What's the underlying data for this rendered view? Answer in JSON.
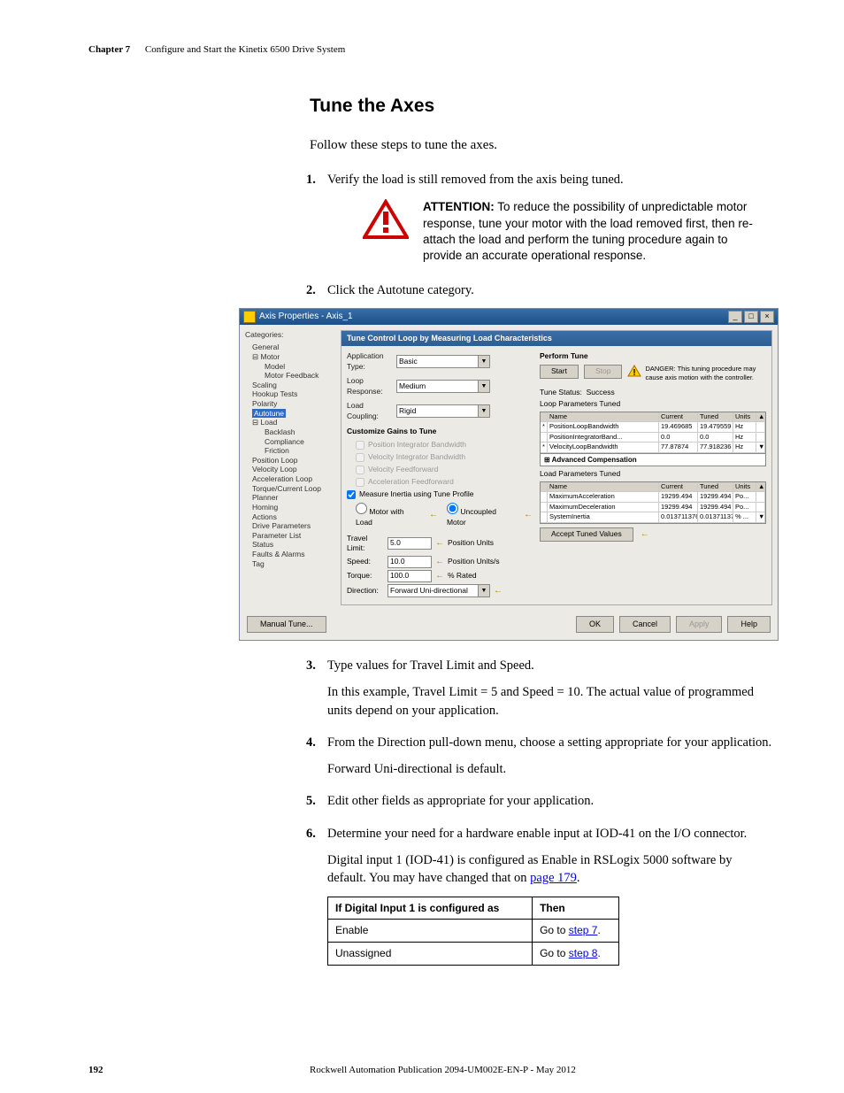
{
  "header": {
    "chapter": "Chapter 7",
    "title": "Configure and Start the Kinetix 6500 Drive System"
  },
  "section_title": "Tune the Axes",
  "intro": "Follow these steps to tune the axes.",
  "steps": {
    "s1": {
      "num": "1.",
      "text": "Verify the load is still removed from the axis being tuned."
    },
    "s2": {
      "num": "2.",
      "text": "Click the Autotune category."
    },
    "s3": {
      "num": "3.",
      "text": "Type values for Travel Limit and Speed.",
      "p1": "In this example, Travel Limit = 5 and Speed = 10. The actual value of programmed units depend on your application."
    },
    "s4": {
      "num": "4.",
      "text": "From the Direction pull-down menu, choose a setting appropriate for your application.",
      "p1": "Forward Uni-directional is default."
    },
    "s5": {
      "num": "5.",
      "text": "Edit other fields as appropriate for your application."
    },
    "s6": {
      "num": "6.",
      "text": "Determine your need for a hardware enable input at IOD-41 on the I/O connector.",
      "p1_a": "Digital input 1 (IOD-41) is configured as Enable in RSLogix 5000 software by default. You may have changed that on ",
      "p1_link": "page 179",
      "p1_b": "."
    }
  },
  "attention": {
    "label": "ATTENTION:",
    "text": " To reduce the possibility of unpredictable motor response, tune your motor with the load removed first, then re-attach the load and perform the tuning procedure again to provide an accurate operational response."
  },
  "dialog": {
    "title": "Axis Properties - Axis_1",
    "categories_label": "Categories:",
    "tree": {
      "general": "General",
      "motor": "Motor",
      "model": "Model",
      "motor_feedback": "Motor Feedback",
      "scaling": "Scaling",
      "hookup": "Hookup Tests",
      "polarity": "Polarity",
      "autotune": "Autotune",
      "load": "Load",
      "backlash": "Backlash",
      "compliance": "Compliance",
      "friction": "Friction",
      "position_loop": "Position Loop",
      "velocity_loop": "Velocity Loop",
      "accel_loop": "Acceleration Loop",
      "torque_loop": "Torque/Current Loop",
      "planner": "Planner",
      "homing": "Homing",
      "actions": "Actions",
      "drive_params": "Drive Parameters",
      "param_list": "Parameter List",
      "status": "Status",
      "faults": "Faults & Alarms",
      "tag": "Tag"
    },
    "bluebar": "Tune Control Loop by Measuring Load Characteristics",
    "left": {
      "app_type_label": "Application Type:",
      "app_type": "Basic",
      "loop_resp_label": "Loop Response:",
      "loop_resp": "Medium",
      "load_coup_label": "Load Coupling:",
      "load_coup": "Rigid",
      "customize_title": "Customize Gains to Tune",
      "g1": "Position Integrator Bandwidth",
      "g2": "Velocity Integrator Bandwidth",
      "g3": "Velocity Feedforward",
      "g4": "Acceleration Feedforward",
      "measure": "Measure Inertia using Tune Profile",
      "motor_load": "Motor with Load",
      "uncoupled": "Uncoupled Motor",
      "travel_label": "Travel Limit:",
      "travel": "5.0",
      "travel_u": "Position Units",
      "speed_label": "Speed:",
      "speed": "10.0",
      "speed_u": "Position Units/s",
      "torque_label": "Torque:",
      "torque": "100.0",
      "torque_u": "% Rated",
      "direction_label": "Direction:",
      "direction": "Forward Uni-directional"
    },
    "right": {
      "perform": "Perform Tune",
      "start": "Start",
      "stop": "Stop",
      "danger": "DANGER: This tuning procedure may cause axis motion with the controller.",
      "tune_status_label": "Tune Status:",
      "tune_status": "Success",
      "loop_params": "Loop Parameters Tuned",
      "advcomp": "Advanced Compensation",
      "load_params": "Load Parameters Tuned",
      "h_name": "Name",
      "h_current": "Current",
      "h_tuned": "Tuned",
      "h_units": "Units",
      "g1": {
        "name": "PositionLoopBandwidth",
        "cur": "19.469685",
        "tuned": "19.479559",
        "u": "Hz"
      },
      "g2": {
        "name": "PositionIntegratorBand...",
        "cur": "0.0",
        "tuned": "0.0",
        "u": "Hz"
      },
      "g3": {
        "name": "VelocityLoopBandwidth",
        "cur": "77.87874",
        "tuned": "77.918236",
        "u": "Hz"
      },
      "l1": {
        "name": "MaximumAcceleration",
        "cur": "19299.494",
        "tuned": "19299.494",
        "u": "Po..."
      },
      "l2": {
        "name": "MaximumDeceleration",
        "cur": "19299.494",
        "tuned": "19299.494",
        "u": "Po..."
      },
      "l3": {
        "name": "SystemInertia",
        "cur": "0.013711376",
        "tuned": "0.013711376",
        "u": "% ..."
      },
      "accept": "Accept Tuned Values"
    },
    "footer": {
      "manual": "Manual Tune...",
      "ok": "OK",
      "cancel": "Cancel",
      "apply": "Apply",
      "help": "Help"
    }
  },
  "iftable": {
    "h1": "If Digital Input 1 is configured as",
    "h2": "Then",
    "r1c1": "Enable",
    "r1_a": "Go to ",
    "r1_link": "step 7",
    "r2c1": "Unassigned",
    "r2_a": "Go to ",
    "r2_link": "step 8"
  },
  "footer": {
    "page": "192",
    "pub": "Rockwell Automation Publication 2094-UM002E-EN-P - May 2012"
  }
}
